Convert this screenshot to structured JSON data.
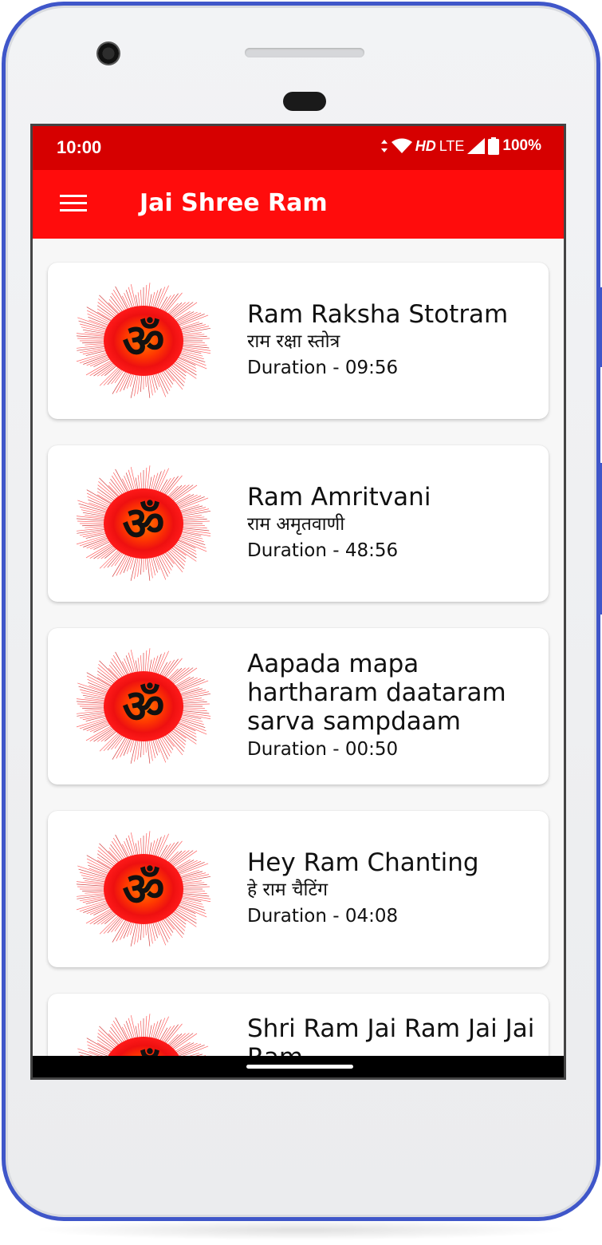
{
  "status_bar": {
    "time": "10:00",
    "hd": "HD",
    "network": "LTE",
    "battery": "100%",
    "icons": [
      "data-arrows-icon",
      "wifi-icon",
      "signal-icon",
      "battery-icon"
    ]
  },
  "app_bar": {
    "title": "Jai Shree Ram",
    "menu_icon": "hamburger-menu-icon"
  },
  "colors": {
    "status_bar": "#d60000",
    "app_bar": "#ff0c0c",
    "phone_frame": "#3f56c9"
  },
  "tracks": [
    {
      "title": "Ram Raksha Stotram",
      "subtitle": "राम रक्षा स्तोत्र",
      "duration": "Duration - 09:56",
      "icon": "om-icon"
    },
    {
      "title": "Ram Amritvani",
      "subtitle": "राम अमृतवाणी",
      "duration": "Duration - 48:56",
      "icon": "om-icon"
    },
    {
      "title": "Aapada mapa hartharam daataram sarva sampdaam",
      "subtitle": "",
      "duration": "Duration - 00:50",
      "icon": "om-icon"
    },
    {
      "title": "Hey Ram Chanting",
      "subtitle": "हे राम चैटिंग",
      "duration": "Duration - 04:08",
      "icon": "om-icon"
    },
    {
      "title": "Shri Ram Jai Ram Jai Jai Ram",
      "subtitle": "",
      "duration": "",
      "icon": "om-icon"
    }
  ]
}
